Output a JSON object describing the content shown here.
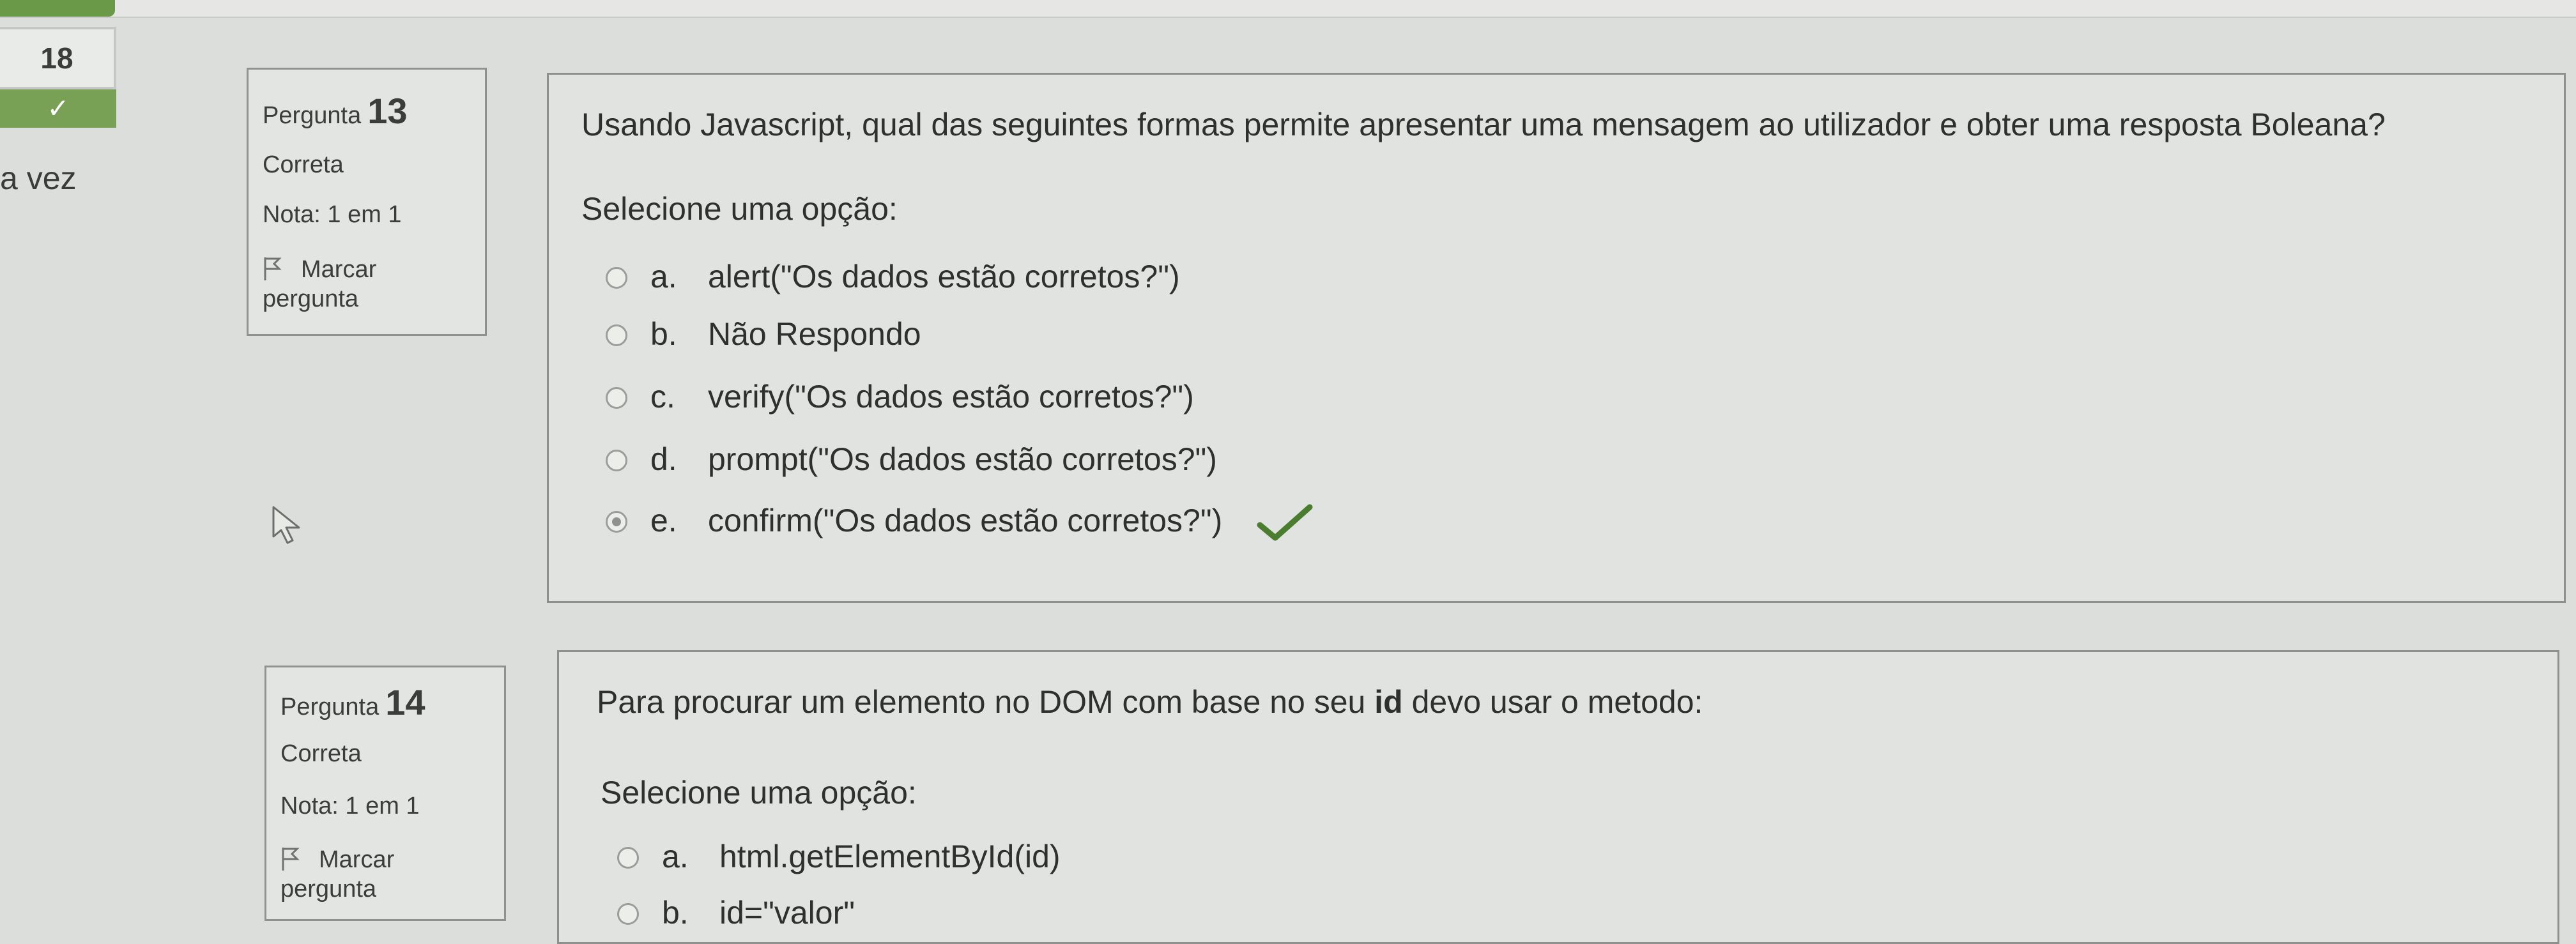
{
  "nav": {
    "number": "18",
    "state_icon": "check-icon"
  },
  "side_text": "a vez",
  "q13": {
    "label": "Pergunta",
    "number": "13",
    "status": "Correta",
    "grade": "Nota: 1 em 1",
    "flag_label": "Marcar pergunta",
    "question": "Usando Javascript, qual das seguintes formas permite apresentar uma mensagem ao utilizador e obter uma resposta Boleana?",
    "prompt": "Selecione uma opção:",
    "options": [
      {
        "letter": "a.",
        "text": "alert(\"Os dados estão corretos?\")",
        "selected": false
      },
      {
        "letter": "b.",
        "text": "Não Respondo",
        "selected": false
      },
      {
        "letter": "c.",
        "text": "verify(\"Os dados estão corretos?\")",
        "selected": false
      },
      {
        "letter": "d.",
        "text": "prompt(\"Os dados estão corretos?\")",
        "selected": false
      },
      {
        "letter": "e.",
        "text": "confirm(\"Os dados estão corretos?\")",
        "selected": true
      }
    ]
  },
  "q14": {
    "label": "Pergunta",
    "number": "14",
    "status": "Correta",
    "grade": "Nota: 1 em 1",
    "flag_label": "Marcar pergunta",
    "question_pre": "Para procurar um elemento no DOM com base no seu ",
    "question_bold": "id",
    "question_post": " devo usar o metodo:",
    "prompt": "Selecione uma opção:",
    "options": [
      {
        "letter": "a.",
        "text": "html.getElementById(id)"
      },
      {
        "letter": "b.",
        "text": "id=\"valor\""
      }
    ]
  },
  "colors": {
    "correct": "#4a7d2e",
    "nav_correct": "#78a155"
  }
}
